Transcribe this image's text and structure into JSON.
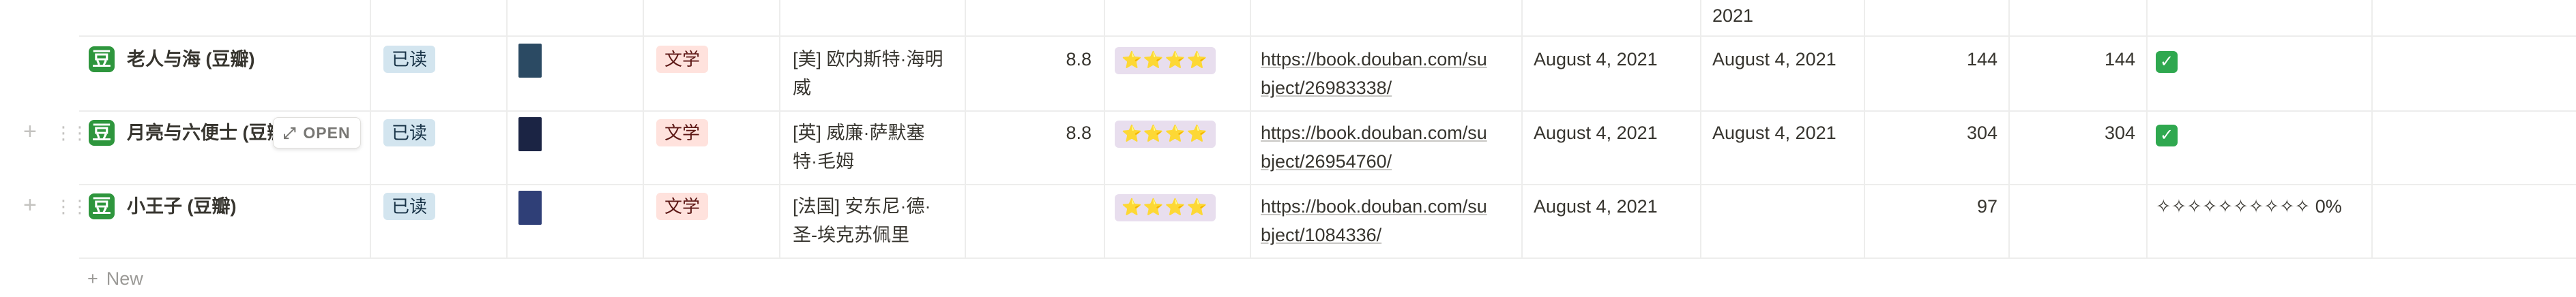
{
  "top_partial_row": {
    "read_date": "2021"
  },
  "rows": [
    {
      "title": "老人与海 (豆瓣)",
      "status": "已读",
      "category": "文学",
      "author_line1": "[美] 欧内斯特·海明",
      "author_line2": "威",
      "score": "8.8",
      "rating": "⭐⭐⭐⭐",
      "url_line1": "https://book.douban.com/su",
      "url_line2": "bject/26983338/",
      "date_added": "August 4, 2021",
      "date_read": "August 4, 2021",
      "pages": "144",
      "pages_read": "144",
      "done": "✅",
      "cover_color": "#2b4a63"
    },
    {
      "title": "月亮与六便士 (豆瓣)",
      "status": "已读",
      "category": "文学",
      "author_line1": "[英] 威廉·萨默塞",
      "author_line2": "特·毛姆",
      "score": "8.8",
      "rating": "⭐⭐⭐⭐",
      "url_line1": "https://book.douban.com/su",
      "url_line2": "bject/26954760/",
      "date_added": "August 4, 2021",
      "date_read": "August 4, 2021",
      "pages": "304",
      "pages_read": "304",
      "done": "✅",
      "cover_color": "#1b2444"
    },
    {
      "title": "小王子 (豆瓣)",
      "status": "已读",
      "category": "文学",
      "author_line1": "[法国] 安东尼·德·",
      "author_line2": "圣-埃克苏佩里",
      "score": "",
      "rating": "⭐⭐⭐⭐",
      "url_line1": "https://book.douban.com/su",
      "url_line2": "bject/1084336/",
      "date_added": "August 4, 2021",
      "date_read": "",
      "pages": "97",
      "pages_read": "",
      "progress_text": "✧✧✧✧✧✧✧✧✧✧ 0%",
      "cover_color": "#2f3f77"
    }
  ],
  "row_hover": {
    "open_label": "OPEN"
  },
  "new_row": {
    "label": "New"
  },
  "icons": {
    "douban": "豆"
  },
  "colors": {
    "douban_green": "#2e963d",
    "status_blue": "#d3e5ef",
    "category_red": "#ffe2dd",
    "rating_purple": "#e8deee"
  }
}
